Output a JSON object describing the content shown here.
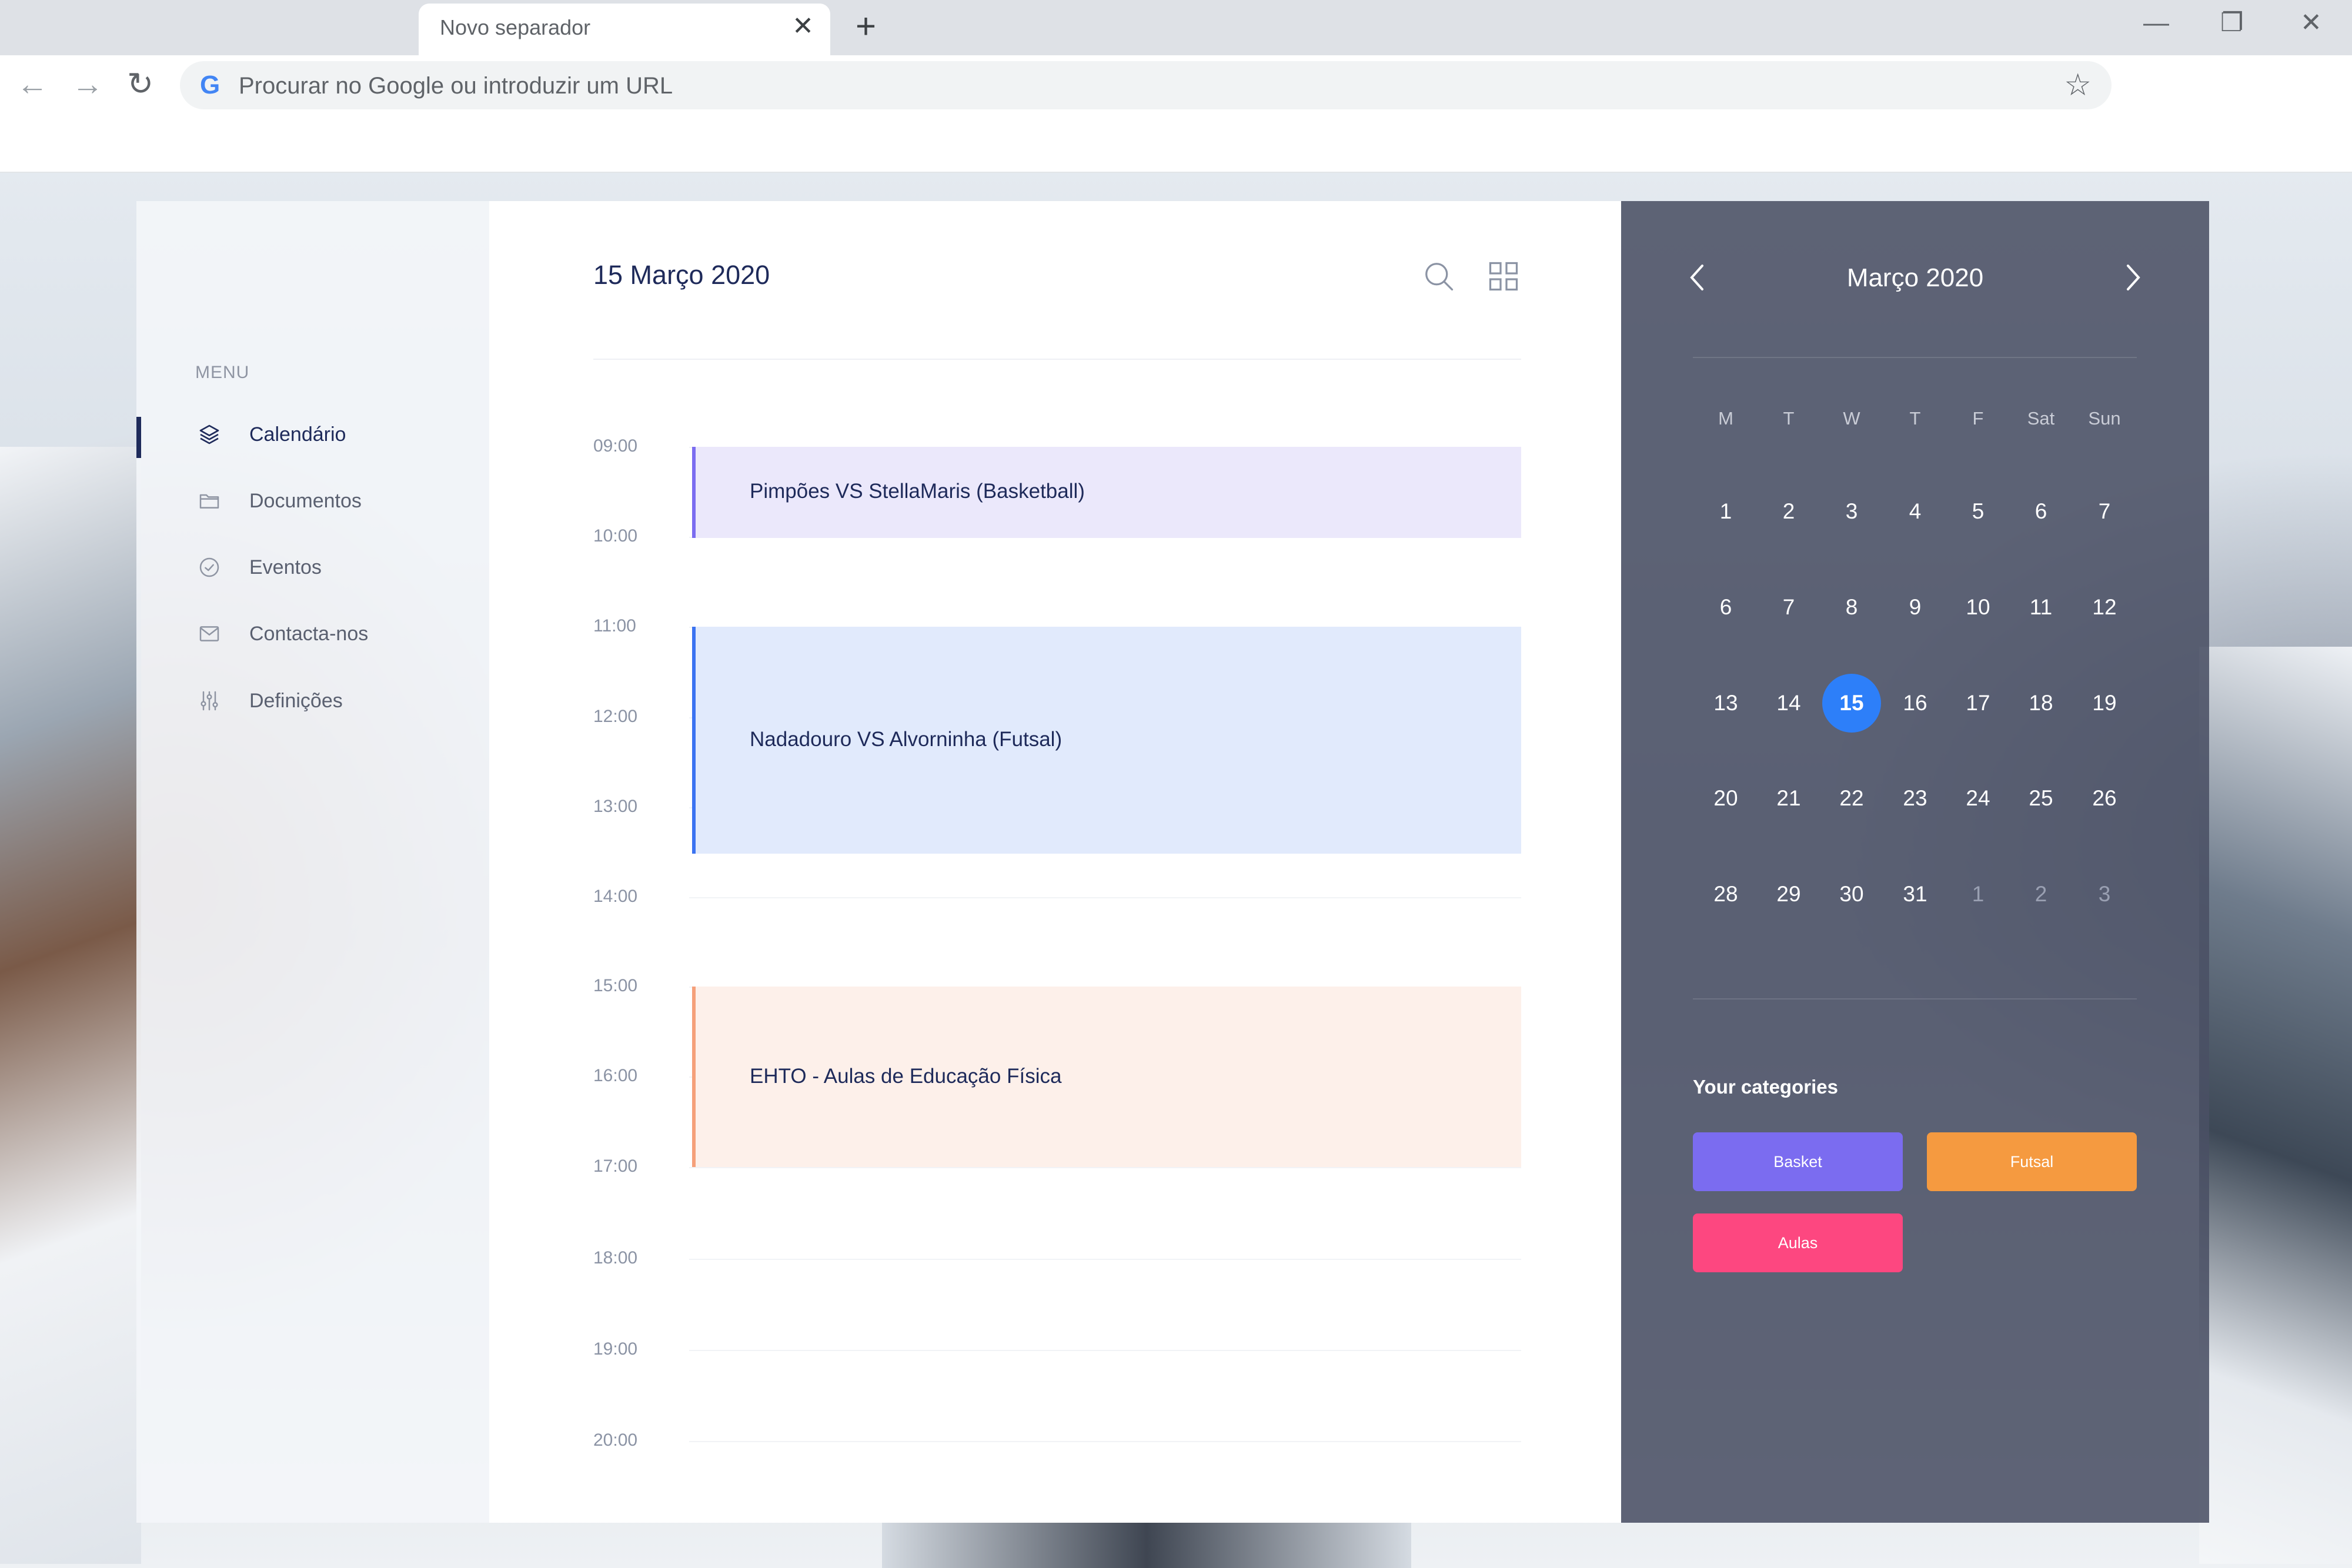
{
  "browser": {
    "tab_title": "Novo separador",
    "omnibox_placeholder": "Procurar no Google ou introduzir um URL",
    "google_glyph": "G",
    "close_glyph": "✕",
    "newtab_glyph": "+"
  },
  "sidebar": {
    "menu_label": "MENU",
    "items": [
      {
        "label": "Calendário",
        "icon": "layers-icon"
      },
      {
        "label": "Documentos",
        "icon": "folder-icon"
      },
      {
        "label": "Eventos",
        "icon": "check-circle-icon"
      },
      {
        "label": "Contacta-nos",
        "icon": "mail-icon"
      },
      {
        "label": "Definições",
        "icon": "sliders-icon"
      }
    ]
  },
  "main": {
    "date_title": "15 Março 2020",
    "times": [
      "09:00",
      "10:00",
      "11:00",
      "12:00",
      "13:00",
      "14:00",
      "15:00",
      "16:00",
      "17:00",
      "18:00",
      "19:00",
      "20:00"
    ],
    "events": [
      {
        "title": "Pimpões VS StellaMaris (Basketball)",
        "bg": "#ebe8fb",
        "accent": "#7b6cf0"
      },
      {
        "title": "Nadadouro VS  Alvorninha (Futsal)",
        "bg": "#e1eafc",
        "accent": "#3b73f1"
      },
      {
        "title": "EHTO - Aulas de Educação Física",
        "bg": "#fdf0ea",
        "accent": "#f5a07a"
      }
    ]
  },
  "calendar": {
    "month_title": "Março 2020",
    "weekdays": [
      "M",
      "T",
      "W",
      "T",
      "F",
      "Sat",
      "Sun"
    ],
    "weeks": [
      [
        "1",
        "2",
        "3",
        "4",
        "5",
        "6",
        "7"
      ],
      [
        "6",
        "7",
        "8",
        "9",
        "10",
        "11",
        "12"
      ],
      [
        "13",
        "14",
        "15",
        "16",
        "17",
        "18",
        "19"
      ],
      [
        "20",
        "21",
        "22",
        "23",
        "24",
        "25",
        "26"
      ],
      [
        "28",
        "29",
        "30",
        "31",
        "1",
        "2",
        "3"
      ]
    ],
    "selected_day": "15",
    "accent_color": "#2d7ff9"
  },
  "categories": {
    "title": "Your categories",
    "items": [
      {
        "label": "Basket",
        "color": "#7b6cf0"
      },
      {
        "label": "Futsal",
        "color": "#f59a40"
      },
      {
        "label": "Aulas",
        "color": "#fd4780"
      }
    ]
  }
}
